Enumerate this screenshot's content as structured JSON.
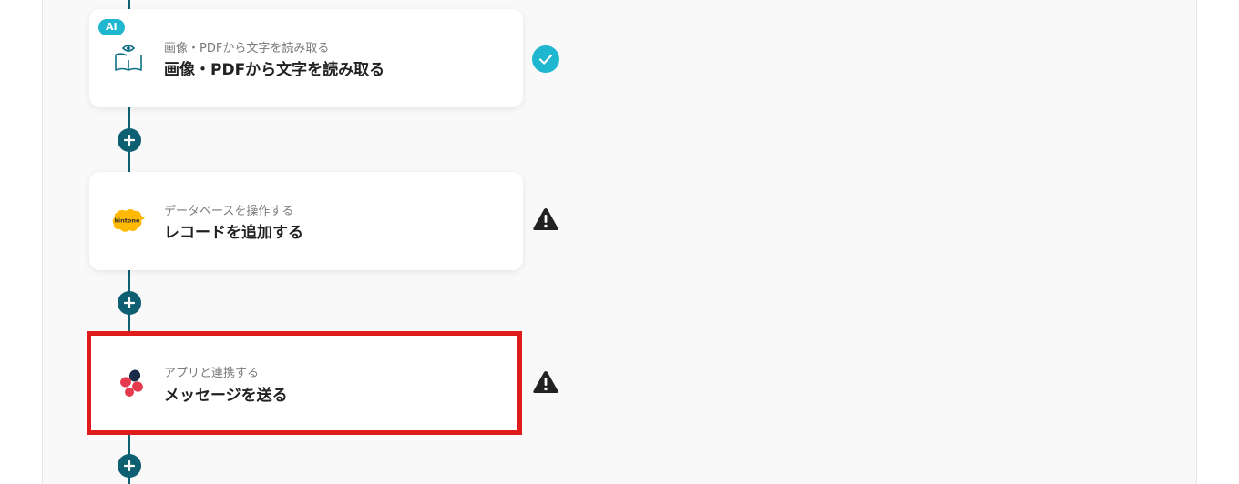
{
  "flow": {
    "steps": [
      {
        "badge": "AI",
        "subtitle": "画像・PDFから文字を読み取る",
        "title": "画像・PDFから文字を読み取る",
        "icon": "book-eye-icon",
        "status": "complete"
      },
      {
        "subtitle": "データベースを操作する",
        "title": "レコードを追加する",
        "icon": "kintone-logo",
        "icon_text": "kintone",
        "status": "warning"
      },
      {
        "subtitle": "アプリと連携する",
        "title": "メッセージを送る",
        "icon": "chatwork-logo",
        "status": "warning",
        "selected": true
      }
    ]
  },
  "colors": {
    "connector": "#0e5f72",
    "check": "#1fb6cf",
    "warning": "#222222",
    "highlight": "#e01b1b",
    "kintone": "#ffb900",
    "chatwork_red": "#e83a4d",
    "chatwork_dark": "#1a2b49"
  }
}
